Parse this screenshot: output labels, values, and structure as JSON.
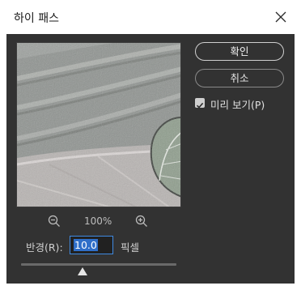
{
  "window": {
    "title": "하이 패스"
  },
  "icons": {
    "close": "close-icon",
    "zoom_out": "zoom-out-icon",
    "zoom_in": "zoom-in-icon",
    "checkmark": "checkmark-icon",
    "slider_thumb": "slider-thumb-triangle"
  },
  "preview": {
    "zoom_level": "100%"
  },
  "radius": {
    "label": "반경(R):",
    "value": "10.0",
    "unit": "픽셀",
    "slider_fraction": 0.42
  },
  "buttons": {
    "ok_label": "확인",
    "cancel_label": "취소"
  },
  "options": {
    "preview_label": "미리 보기(P)",
    "preview_checked": true
  },
  "colors": {
    "panel_bg": "#323232",
    "input_focus_border": "#3f8ae2",
    "selection_bg": "#2f6fc9"
  }
}
